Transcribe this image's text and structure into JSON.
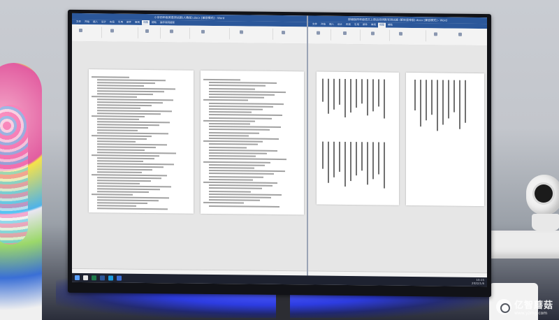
{
  "scene": {
    "description_tags": [
      "monitor",
      "word-documents"
    ]
  },
  "left_window": {
    "title": "小学四年级英语测试题(人教版).docx [兼容模式] - Word",
    "tabs": [
      "文件",
      "开始",
      "插入",
      "设计",
      "布局",
      "引用",
      "邮件",
      "审阅",
      "视图",
      "帮助",
      "操作说明搜索"
    ],
    "active_tab": "视图"
  },
  "right_window": {
    "title": "部编版四年级语文上册古诗词默写测试题 (繁体竖排版).docx [兼容模式] - Word",
    "tabs": [
      "文件",
      "开始",
      "插入",
      "设计",
      "布局",
      "引用",
      "邮件",
      "审阅",
      "视图",
      "帮助"
    ],
    "active_tab": "视图"
  },
  "taskbar": {
    "time": "10:15",
    "date": "2022/1/6"
  },
  "watermark": {
    "brand": "亿智蘑菇",
    "url": "www.yzmg.com"
  }
}
